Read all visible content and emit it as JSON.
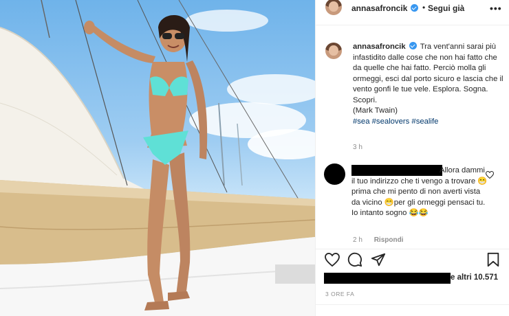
{
  "post": {
    "username": "annasafroncik",
    "follow_label": "Segui già",
    "dot": "•",
    "more_label": "•••",
    "caption_username": "annasafroncik",
    "caption_text": "Tra vent'anni sarai più infastidito dalle cose che non hai fatto che da quelle che hai fatto. Perciò molla gli ormeggi, esci dal porto sicuro e lascia che il vento gonfi le tue vele. Esplora. Sogna. Scopri.\n(Mark Twain)",
    "hashtags": [
      "#sea",
      "#sealovers",
      "#sealife"
    ],
    "caption_time": "3 h",
    "likes_text": "e altri 10.571",
    "date": "3 ORE FA"
  },
  "comment": {
    "text_line1": "Allora",
    "text_rest": "dammi il tuo indirizzo che ti vengo a trovare 😁prima che mi pento di non averti vista da vicino 😁per gli ormeggi pensaci tu. Io intanto sogno 😂😂",
    "time": "2 h",
    "reply_label": "Rispondi"
  },
  "icons": {
    "like": "heart-icon",
    "comment": "comment-bubble-icon",
    "share": "paper-plane-icon",
    "save": "bookmark-icon",
    "comment_like": "heart-outline-icon",
    "verified": "verified-badge-icon"
  },
  "colors": {
    "verified": "#3897f0",
    "hashtag": "#00376b",
    "muted": "#8e8e8e",
    "text": "#262626",
    "bikini": "#5fe0d6"
  }
}
